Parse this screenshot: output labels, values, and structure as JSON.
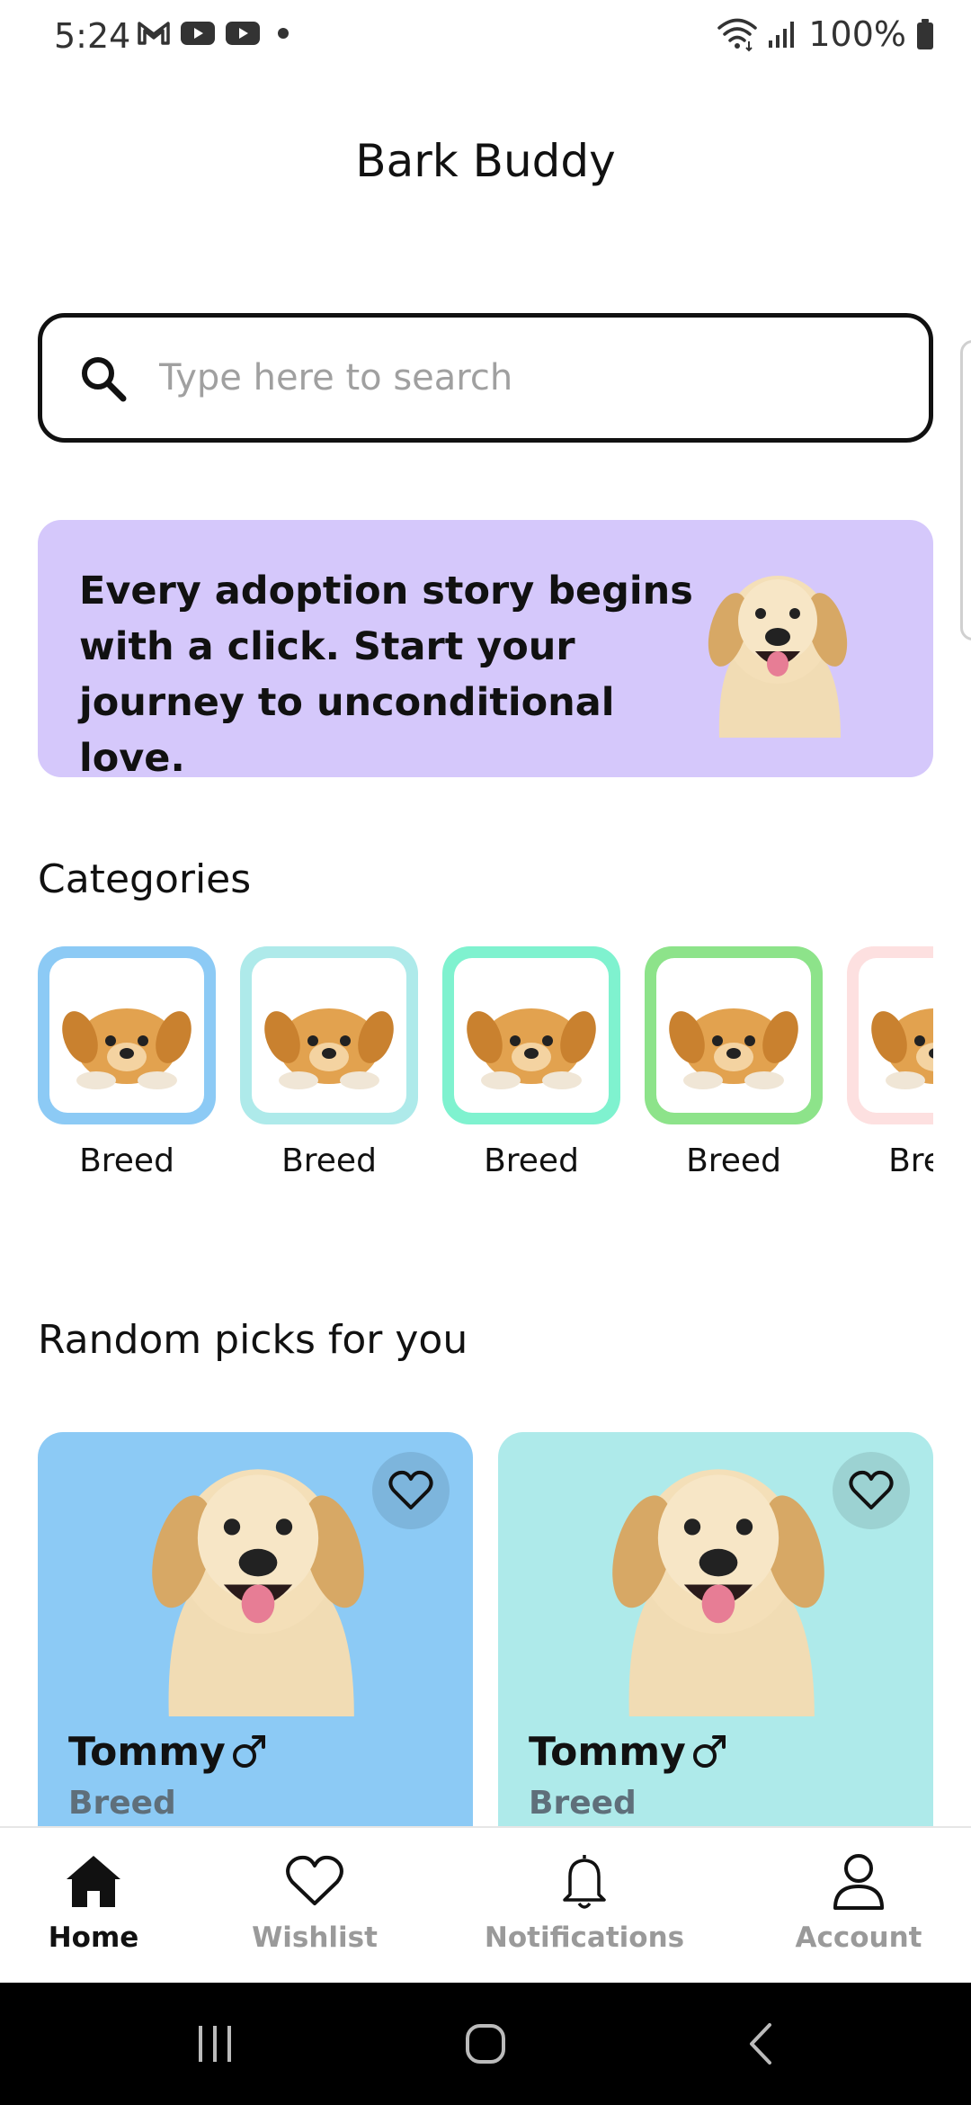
{
  "status_bar": {
    "time": "5:24",
    "battery": "100%",
    "notification_icons": [
      "gmail-icon",
      "youtube-icon",
      "youtube-icon",
      "dot-icon"
    ],
    "right_icons": [
      "wifi-icon",
      "signal-icon",
      "battery-icon"
    ]
  },
  "header": {
    "title": "Bark Buddy"
  },
  "search": {
    "placeholder": "Type here to search",
    "value": ""
  },
  "banner": {
    "text": "Every adoption story begins with a click. Start your journey to unconditional love.",
    "background": "#d5c8fb"
  },
  "categories": {
    "title": "Categories",
    "items": [
      {
        "label": "Breed",
        "color": "#8ccaf5"
      },
      {
        "label": "Breed",
        "color": "#aeeaea"
      },
      {
        "label": "Breed",
        "color": "#7ff2cf"
      },
      {
        "label": "Breed",
        "color": "#8de38a"
      },
      {
        "label": "Breed",
        "color": "#fde0e0"
      }
    ]
  },
  "picks": {
    "title": "Random picks for you",
    "items": [
      {
        "name": "Tommy",
        "gender": "male",
        "breed": "Breed",
        "color": "#8ccaf5"
      },
      {
        "name": "Tommy",
        "gender": "male",
        "breed": "Breed",
        "color": "#aeeaea"
      }
    ]
  },
  "nav": {
    "items": [
      {
        "label": "Home",
        "icon": "home-icon",
        "active": true
      },
      {
        "label": "Wishlist",
        "icon": "heart-icon",
        "active": false
      },
      {
        "label": "Notifications",
        "icon": "bell-icon",
        "active": false
      },
      {
        "label": "Account",
        "icon": "user-icon",
        "active": false
      }
    ]
  },
  "system_nav": {
    "buttons": [
      "recents-icon",
      "home-circle-icon",
      "back-icon"
    ]
  }
}
